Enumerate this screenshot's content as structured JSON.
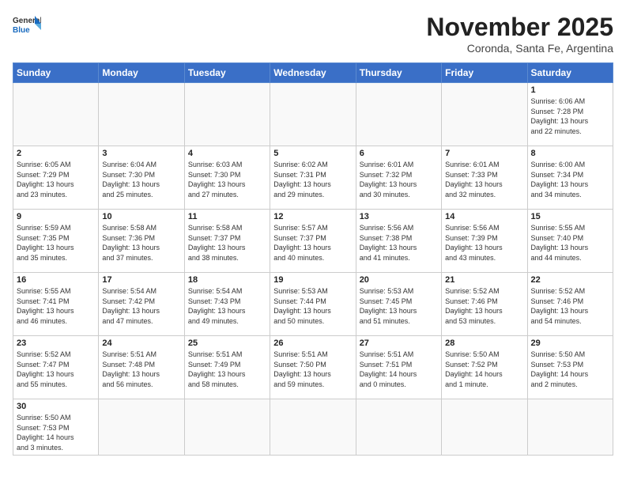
{
  "header": {
    "logo_line1": "General",
    "logo_line2": "Blue",
    "month": "November 2025",
    "location": "Coronda, Santa Fe, Argentina"
  },
  "weekdays": [
    "Sunday",
    "Monday",
    "Tuesday",
    "Wednesday",
    "Thursday",
    "Friday",
    "Saturday"
  ],
  "weeks": [
    [
      {
        "day": "",
        "info": ""
      },
      {
        "day": "",
        "info": ""
      },
      {
        "day": "",
        "info": ""
      },
      {
        "day": "",
        "info": ""
      },
      {
        "day": "",
        "info": ""
      },
      {
        "day": "",
        "info": ""
      },
      {
        "day": "1",
        "info": "Sunrise: 6:06 AM\nSunset: 7:28 PM\nDaylight: 13 hours\nand 22 minutes."
      }
    ],
    [
      {
        "day": "2",
        "info": "Sunrise: 6:05 AM\nSunset: 7:29 PM\nDaylight: 13 hours\nand 23 minutes."
      },
      {
        "day": "3",
        "info": "Sunrise: 6:04 AM\nSunset: 7:30 PM\nDaylight: 13 hours\nand 25 minutes."
      },
      {
        "day": "4",
        "info": "Sunrise: 6:03 AM\nSunset: 7:30 PM\nDaylight: 13 hours\nand 27 minutes."
      },
      {
        "day": "5",
        "info": "Sunrise: 6:02 AM\nSunset: 7:31 PM\nDaylight: 13 hours\nand 29 minutes."
      },
      {
        "day": "6",
        "info": "Sunrise: 6:01 AM\nSunset: 7:32 PM\nDaylight: 13 hours\nand 30 minutes."
      },
      {
        "day": "7",
        "info": "Sunrise: 6:01 AM\nSunset: 7:33 PM\nDaylight: 13 hours\nand 32 minutes."
      },
      {
        "day": "8",
        "info": "Sunrise: 6:00 AM\nSunset: 7:34 PM\nDaylight: 13 hours\nand 34 minutes."
      }
    ],
    [
      {
        "day": "9",
        "info": "Sunrise: 5:59 AM\nSunset: 7:35 PM\nDaylight: 13 hours\nand 35 minutes."
      },
      {
        "day": "10",
        "info": "Sunrise: 5:58 AM\nSunset: 7:36 PM\nDaylight: 13 hours\nand 37 minutes."
      },
      {
        "day": "11",
        "info": "Sunrise: 5:58 AM\nSunset: 7:37 PM\nDaylight: 13 hours\nand 38 minutes."
      },
      {
        "day": "12",
        "info": "Sunrise: 5:57 AM\nSunset: 7:37 PM\nDaylight: 13 hours\nand 40 minutes."
      },
      {
        "day": "13",
        "info": "Sunrise: 5:56 AM\nSunset: 7:38 PM\nDaylight: 13 hours\nand 41 minutes."
      },
      {
        "day": "14",
        "info": "Sunrise: 5:56 AM\nSunset: 7:39 PM\nDaylight: 13 hours\nand 43 minutes."
      },
      {
        "day": "15",
        "info": "Sunrise: 5:55 AM\nSunset: 7:40 PM\nDaylight: 13 hours\nand 44 minutes."
      }
    ],
    [
      {
        "day": "16",
        "info": "Sunrise: 5:55 AM\nSunset: 7:41 PM\nDaylight: 13 hours\nand 46 minutes."
      },
      {
        "day": "17",
        "info": "Sunrise: 5:54 AM\nSunset: 7:42 PM\nDaylight: 13 hours\nand 47 minutes."
      },
      {
        "day": "18",
        "info": "Sunrise: 5:54 AM\nSunset: 7:43 PM\nDaylight: 13 hours\nand 49 minutes."
      },
      {
        "day": "19",
        "info": "Sunrise: 5:53 AM\nSunset: 7:44 PM\nDaylight: 13 hours\nand 50 minutes."
      },
      {
        "day": "20",
        "info": "Sunrise: 5:53 AM\nSunset: 7:45 PM\nDaylight: 13 hours\nand 51 minutes."
      },
      {
        "day": "21",
        "info": "Sunrise: 5:52 AM\nSunset: 7:46 PM\nDaylight: 13 hours\nand 53 minutes."
      },
      {
        "day": "22",
        "info": "Sunrise: 5:52 AM\nSunset: 7:46 PM\nDaylight: 13 hours\nand 54 minutes."
      }
    ],
    [
      {
        "day": "23",
        "info": "Sunrise: 5:52 AM\nSunset: 7:47 PM\nDaylight: 13 hours\nand 55 minutes."
      },
      {
        "day": "24",
        "info": "Sunrise: 5:51 AM\nSunset: 7:48 PM\nDaylight: 13 hours\nand 56 minutes."
      },
      {
        "day": "25",
        "info": "Sunrise: 5:51 AM\nSunset: 7:49 PM\nDaylight: 13 hours\nand 58 minutes."
      },
      {
        "day": "26",
        "info": "Sunrise: 5:51 AM\nSunset: 7:50 PM\nDaylight: 13 hours\nand 59 minutes."
      },
      {
        "day": "27",
        "info": "Sunrise: 5:51 AM\nSunset: 7:51 PM\nDaylight: 14 hours\nand 0 minutes."
      },
      {
        "day": "28",
        "info": "Sunrise: 5:50 AM\nSunset: 7:52 PM\nDaylight: 14 hours\nand 1 minute."
      },
      {
        "day": "29",
        "info": "Sunrise: 5:50 AM\nSunset: 7:53 PM\nDaylight: 14 hours\nand 2 minutes."
      }
    ],
    [
      {
        "day": "30",
        "info": "Sunrise: 5:50 AM\nSunset: 7:53 PM\nDaylight: 14 hours\nand 3 minutes."
      },
      {
        "day": "",
        "info": ""
      },
      {
        "day": "",
        "info": ""
      },
      {
        "day": "",
        "info": ""
      },
      {
        "day": "",
        "info": ""
      },
      {
        "day": "",
        "info": ""
      },
      {
        "day": "",
        "info": ""
      }
    ]
  ]
}
